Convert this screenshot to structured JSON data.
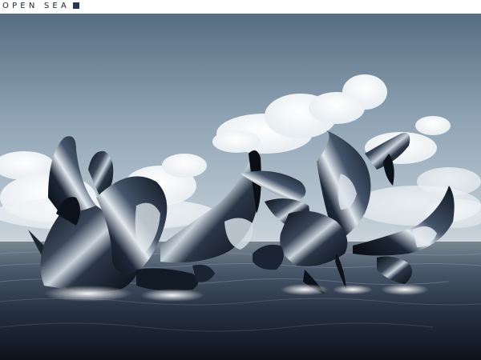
{
  "header": {
    "title": "OPEN SEA"
  },
  "artwork": {
    "sky_top": "#5d7387",
    "sky_mid": "#93a8b9",
    "horizon": "#c8d3da",
    "sea_light": "#6d7a86",
    "sea_dark": "#101a25",
    "sculpture_dark": "#0e1520",
    "sculpture_highlight": "#dfe6ec",
    "accent_blue": "#5a7fa8"
  }
}
